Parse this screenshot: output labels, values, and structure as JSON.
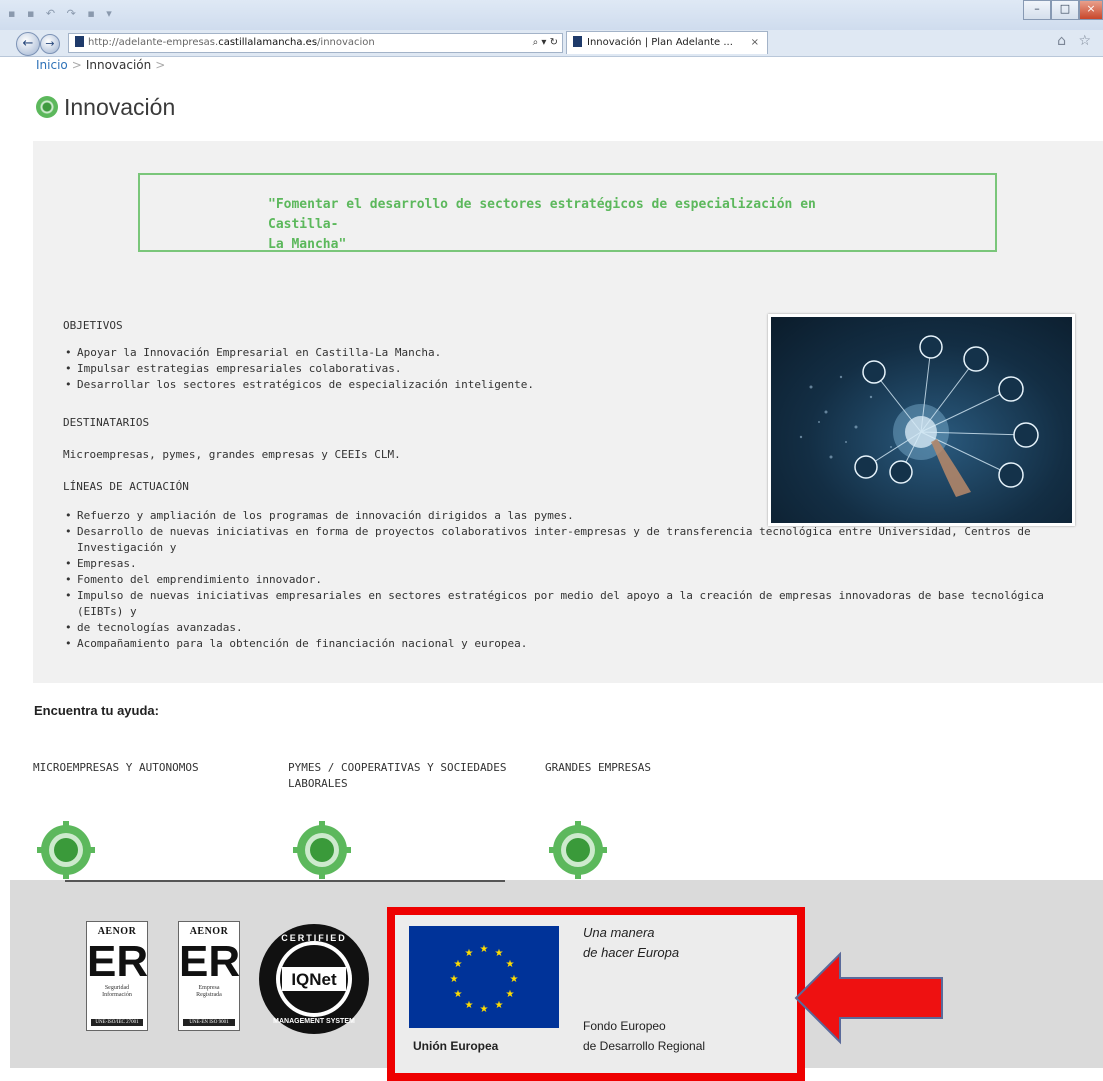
{
  "browser": {
    "url_prefix": "http://adelante-empresas.",
    "url_domain": "castillalamancha.es",
    "url_path": "/innovacion",
    "search_control": "⌕ ▾ ↻",
    "tab_title": "Innovación | Plan Adelante ...",
    "tab_close": "×",
    "back_glyph": "←",
    "forward_glyph": "→",
    "minimize_glyph": "–",
    "restore_glyph": "□",
    "close_glyph": "×",
    "toolbar_icons": "⌂ ☆"
  },
  "breadcrumb": {
    "home": "Inicio",
    "sep": ">",
    "current": "Innovación",
    "trail": ">"
  },
  "page": {
    "title": "Innovación",
    "quote_line1": "\"Fomentar el desarrollo de sectores estratégicos de especialización en Castilla-",
    "quote_line2": "La Mancha\""
  },
  "objetivos": {
    "heading": "OBJETIVOS",
    "items": [
      "Apoyar la Innovación Empresarial en Castilla-La Mancha.",
      "Impulsar estrategias empresariales colaborativas.",
      "Desarrollar los sectores estratégicos de especialización inteligente."
    ]
  },
  "destinatarios": {
    "heading": "DESTINATARIOS",
    "text": "Microempresas, pymes, grandes empresas y CEEIs CLM."
  },
  "lineas": {
    "heading": "LÍNEAS DE ACTUACIÓN",
    "items": [
      "Refuerzo y ampliación de los programas de innovación dirigidos a las  pymes.",
      "Desarrollo de nuevas iniciativas en forma de proyectos colaborativos inter-empresas y de transferencia tecnológica entre Universidad, Centros de Investigación y",
      "Empresas.",
      "Fomento del emprendimiento innovador.",
      "Impulso de nuevas iniciativas empresariales en sectores estratégicos por medio del apoyo a la creación de empresas innovadoras de base tecnológica (EIBTs) y",
      "de tecnologías avanzadas.",
      "Acompañamiento para la obtención de financiación nacional y europea."
    ]
  },
  "ayuda": {
    "title": "Encuentra tu ayuda:",
    "cat1": "MICROEMPRESAS Y AUTONOMOS",
    "cat2_line1": "PYMES / COOPERATIVAS Y SOCIEDADES",
    "cat2_line2": "LABORALES",
    "cat3": "GRANDES EMPRESAS"
  },
  "footer": {
    "aenor1": {
      "head": "AENOR",
      "er": "ER",
      "sub1": "Seguridad",
      "sub2": "Información",
      "code": "UNE-ISO/IEC 27001"
    },
    "aenor2": {
      "head": "AENOR",
      "er": "ER",
      "sub1": "Empresa",
      "sub2": "Registrada",
      "code": "UNE-EN ISO 9001"
    },
    "iqnet_top": "CERTIFIED",
    "iqnet_name": "IQNet",
    "iqnet_bottom": "MANAGEMENT SYSTEM",
    "eu_label": "Unión Europea",
    "eu_slogan_1": "Una manera",
    "eu_slogan_2": "de hacer Europa",
    "eu_fund_1": "Fondo Europeo",
    "eu_fund_2": "de Desarrollo Regional"
  },
  "colors": {
    "accent_green": "#5cb85c",
    "highlight_red": "#ee0000",
    "eu_blue": "#003399",
    "eu_star": "#ffdd00"
  }
}
